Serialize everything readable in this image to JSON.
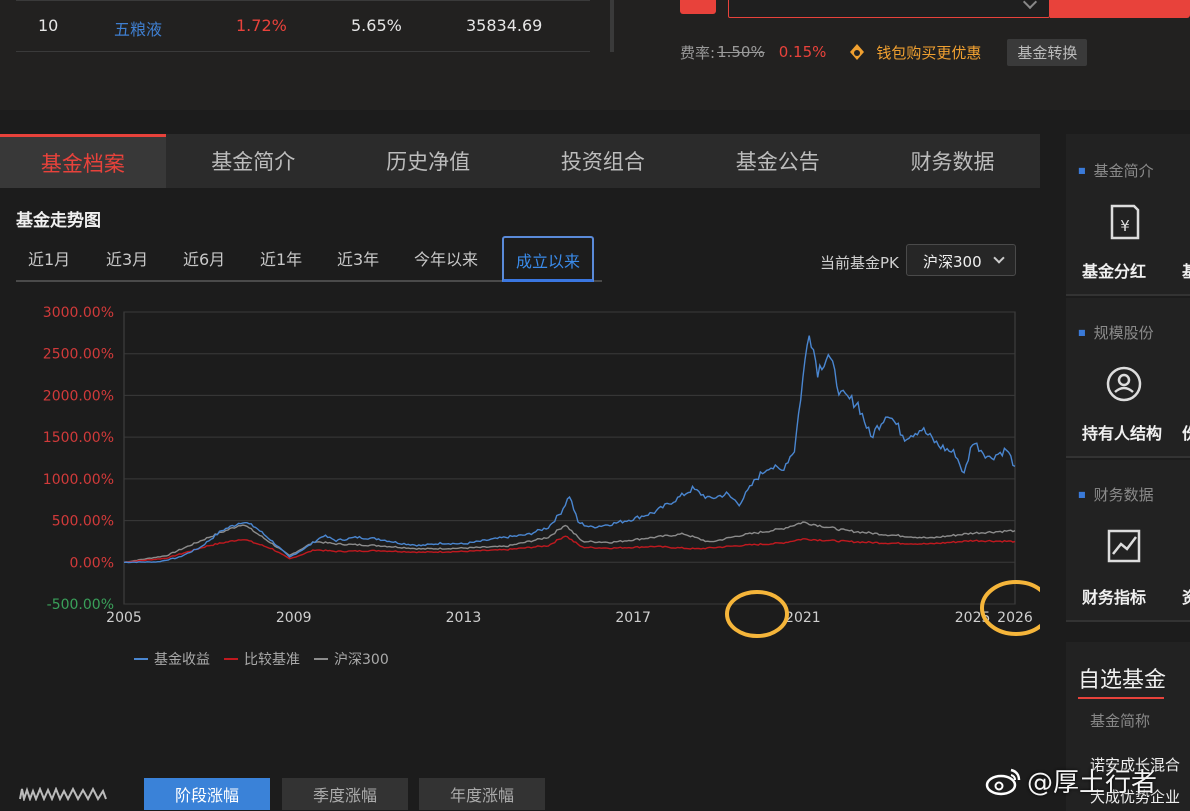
{
  "holdings_row": {
    "rank": "10",
    "name": "五粮液",
    "pct_nav": "1.72%",
    "pct_change": "5.65%",
    "market_value": "35834.69"
  },
  "purchase": {
    "fee_label": "费率:",
    "fee_original": "1.50%",
    "fee_discounted": "0.15%",
    "wallet_promo": "钱包购买更优惠",
    "convert_label": "基金转换"
  },
  "tabs": [
    {
      "label": "基金档案",
      "active": true
    },
    {
      "label": "基金简介"
    },
    {
      "label": "历史净值"
    },
    {
      "label": "投资组合"
    },
    {
      "label": "基金公告"
    },
    {
      "label": "财务数据"
    }
  ],
  "chart_title": "基金走势图",
  "ranges": [
    {
      "label": "近1月"
    },
    {
      "label": "近3月"
    },
    {
      "label": "近6月"
    },
    {
      "label": "近1年"
    },
    {
      "label": "近3年"
    },
    {
      "label": "今年以来"
    },
    {
      "label": "成立以来",
      "active": true
    }
  ],
  "pk": {
    "label": "当前基金PK",
    "selected": "沪深300"
  },
  "chart_data": {
    "type": "line",
    "title": "",
    "xlabel": "",
    "ylabel": "",
    "x_ticks": [
      "2005",
      "2009",
      "2013",
      "2017",
      "2021",
      "2025",
      "2026"
    ],
    "y_ticks": [
      "3000.00%",
      "2500.00%",
      "2000.00%",
      "1500.00%",
      "1000.00%",
      "500.00%",
      "0.00%",
      "-500.00%"
    ],
    "xlim": [
      2005,
      2026
    ],
    "ylim": [
      -500,
      3000
    ],
    "series": [
      {
        "name": "基金收益",
        "color": "#4a86d0",
        "points": [
          [
            2005,
            0
          ],
          [
            2005.8,
            5
          ],
          [
            2006.3,
            60
          ],
          [
            2006.8,
            180
          ],
          [
            2007.3,
            380
          ],
          [
            2007.8,
            490
          ],
          [
            2008.1,
            420
          ],
          [
            2008.5,
            250
          ],
          [
            2008.9,
            60
          ],
          [
            2009.3,
            180
          ],
          [
            2009.7,
            320
          ],
          [
            2010.0,
            260
          ],
          [
            2010.5,
            300
          ],
          [
            2011.0,
            280
          ],
          [
            2011.5,
            230
          ],
          [
            2012.0,
            200
          ],
          [
            2012.5,
            230
          ],
          [
            2013.0,
            220
          ],
          [
            2013.5,
            260
          ],
          [
            2014.0,
            300
          ],
          [
            2014.5,
            330
          ],
          [
            2015.0,
            420
          ],
          [
            2015.3,
            600
          ],
          [
            2015.5,
            800
          ],
          [
            2015.7,
            480
          ],
          [
            2016.0,
            420
          ],
          [
            2016.5,
            460
          ],
          [
            2017.0,
            520
          ],
          [
            2017.5,
            600
          ],
          [
            2018.0,
            750
          ],
          [
            2018.4,
            880
          ],
          [
            2018.8,
            760
          ],
          [
            2019.2,
            820
          ],
          [
            2019.5,
            700
          ],
          [
            2019.9,
            1000
          ],
          [
            2020.2,
            1150
          ],
          [
            2020.5,
            1100
          ],
          [
            2020.8,
            1350
          ],
          [
            2021.0,
            2200
          ],
          [
            2021.15,
            2800
          ],
          [
            2021.35,
            2300
          ],
          [
            2021.6,
            2500
          ],
          [
            2021.9,
            2000
          ],
          [
            2022.3,
            1900
          ],
          [
            2022.6,
            1500
          ],
          [
            2023.0,
            1800
          ],
          [
            2023.4,
            1500
          ],
          [
            2023.8,
            1600
          ],
          [
            2024.2,
            1400
          ],
          [
            2024.6,
            1300
          ],
          [
            2024.8,
            1050
          ],
          [
            2025.0,
            1450
          ],
          [
            2025.4,
            1250
          ],
          [
            2025.8,
            1350
          ],
          [
            2026.0,
            1150
          ]
        ]
      },
      {
        "name": "比较基准",
        "color": "#c0191f",
        "points": [
          [
            2005,
            0
          ],
          [
            2006,
            50
          ],
          [
            2007,
            200
          ],
          [
            2007.8,
            280
          ],
          [
            2008.5,
            160
          ],
          [
            2008.9,
            40
          ],
          [
            2009.5,
            150
          ],
          [
            2010,
            130
          ],
          [
            2011,
            140
          ],
          [
            2012,
            120
          ],
          [
            2013,
            130
          ],
          [
            2014,
            150
          ],
          [
            2015,
            200
          ],
          [
            2015.4,
            320
          ],
          [
            2015.8,
            180
          ],
          [
            2016.5,
            170
          ],
          [
            2017.5,
            190
          ],
          [
            2018.5,
            160
          ],
          [
            2019.5,
            200
          ],
          [
            2020.5,
            230
          ],
          [
            2021,
            280
          ],
          [
            2022,
            250
          ],
          [
            2023,
            230
          ],
          [
            2024,
            220
          ],
          [
            2025,
            260
          ],
          [
            2026,
            250
          ]
        ]
      },
      {
        "name": "沪深300",
        "color": "#8c8c8c",
        "points": [
          [
            2005,
            0
          ],
          [
            2006,
            80
          ],
          [
            2007,
            300
          ],
          [
            2007.8,
            460
          ],
          [
            2008.5,
            220
          ],
          [
            2008.9,
            80
          ],
          [
            2009.5,
            250
          ],
          [
            2010,
            220
          ],
          [
            2011,
            200
          ],
          [
            2012,
            160
          ],
          [
            2013,
            170
          ],
          [
            2014,
            190
          ],
          [
            2015,
            300
          ],
          [
            2015.4,
            450
          ],
          [
            2015.8,
            250
          ],
          [
            2016.5,
            240
          ],
          [
            2017.5,
            300
          ],
          [
            2018.2,
            340
          ],
          [
            2018.8,
            240
          ],
          [
            2019.5,
            320
          ],
          [
            2020.5,
            400
          ],
          [
            2021,
            480
          ],
          [
            2022,
            380
          ],
          [
            2023,
            330
          ],
          [
            2024,
            290
          ],
          [
            2025,
            350
          ],
          [
            2026,
            380
          ]
        ]
      }
    ]
  },
  "bottom_tabs": [
    {
      "label": "阶段涨幅",
      "active": true
    },
    {
      "label": "季度涨幅"
    },
    {
      "label": "年度涨幅"
    }
  ],
  "sidebar": {
    "sections": [
      {
        "heading": "基金简介",
        "label": "基金分红",
        "partial": "基",
        "icon": "dividend-icon"
      },
      {
        "heading": "规模股份",
        "label": "持有人结构",
        "partial": "份",
        "icon": "holder-icon"
      },
      {
        "heading": "财务数据",
        "label": "财务指标",
        "partial": "资",
        "icon": "chart-icon"
      }
    ],
    "watchlist": {
      "title": "自选基金",
      "column": "基金简称",
      "items": [
        "诺安成长混合",
        "大成优势企业"
      ]
    }
  },
  "watermark": "@厚土行者",
  "colors": {
    "accent": "#e8423b",
    "primary_blue": "#3a82d8",
    "fund_line": "#4a86d0"
  }
}
